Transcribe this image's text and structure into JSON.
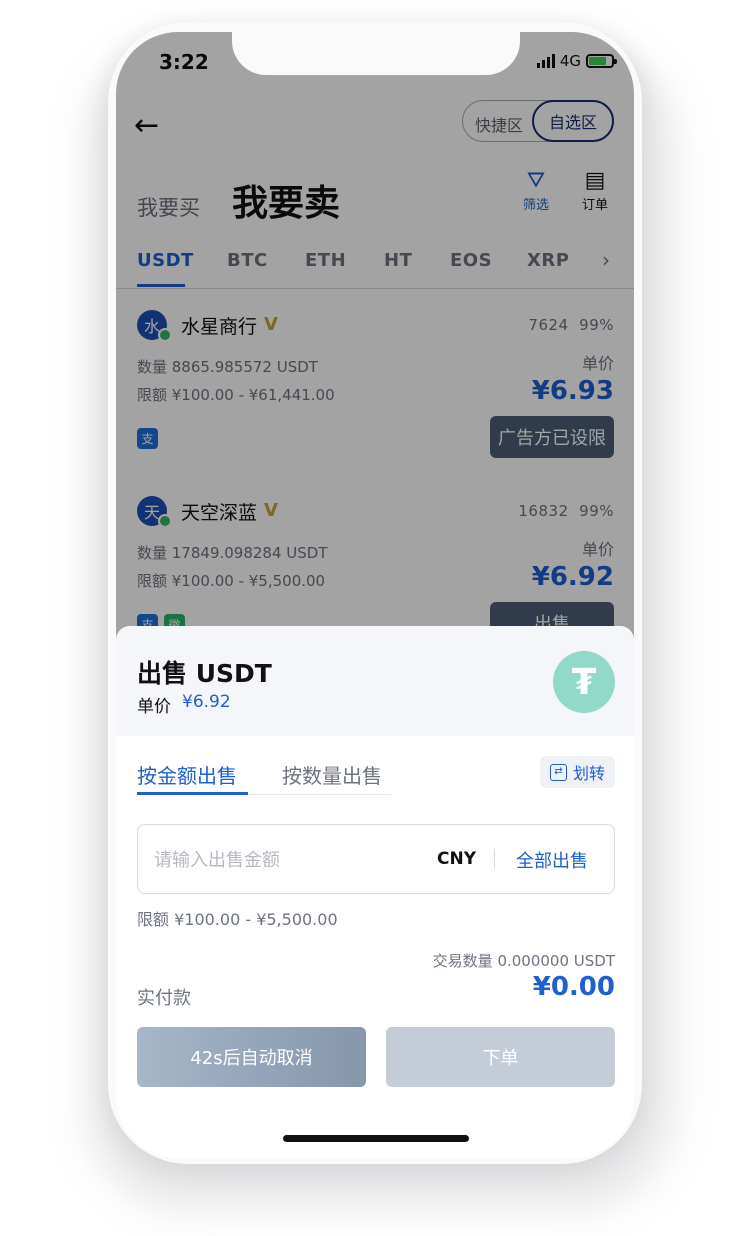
{
  "status_bar": {
    "time": "3:22",
    "network": "4G"
  },
  "header": {
    "back_icon": "arrow-left-icon",
    "zone_quick": "快捷区",
    "zone_mine": "自选区",
    "tab_buy": "我要买",
    "tab_sell": "我要卖",
    "filter_label": "筛选",
    "order_label": "订单"
  },
  "coin_tabs": [
    "USDT",
    "BTC",
    "ETH",
    "HT",
    "EOS",
    "XRP"
  ],
  "active_coin": "USDT",
  "ads": [
    {
      "avatar": "水",
      "name": "水星商行",
      "badge": "V",
      "orders": "7624",
      "completion": "99%",
      "quantity": "数量 8865.985572 USDT",
      "limit": "限额 ¥100.00 - ¥61,441.00",
      "unit_label": "单价",
      "price": "¥6.93",
      "pay_methods": [
        "支"
      ],
      "action": "广告方已设限"
    },
    {
      "avatar": "天",
      "name": "天空深蓝",
      "badge": "V",
      "orders": "16832",
      "completion": "99%",
      "quantity": "数量 17849.098284 USDT",
      "limit": "限额 ¥100.00 - ¥5,500.00",
      "unit_label": "单价",
      "price": "¥6.92",
      "pay_methods": [
        "支",
        "微"
      ],
      "action": "出售"
    }
  ],
  "sheet": {
    "title": "出售 USDT",
    "price_label": "单价",
    "price": "¥6.92",
    "logo_glyph": "₮",
    "tab_amount": "按金额出售",
    "tab_quantity": "按数量出售",
    "transfer": "划转",
    "input_placeholder": "请输入出售金额",
    "currency": "CNY",
    "sell_all": "全部出售",
    "range": "限额 ¥100.00 - ¥5,500.00",
    "trade_qty": "交易数量 0.000000 USDT",
    "pay_label": "实付款",
    "pay_amount": "¥0.00",
    "cancel_button": "42s后自动取消",
    "order_button": "下单"
  },
  "colors": {
    "accent": "#1f5fcf",
    "tether": "#93d9c9",
    "disabled": "#c3ccd7"
  }
}
